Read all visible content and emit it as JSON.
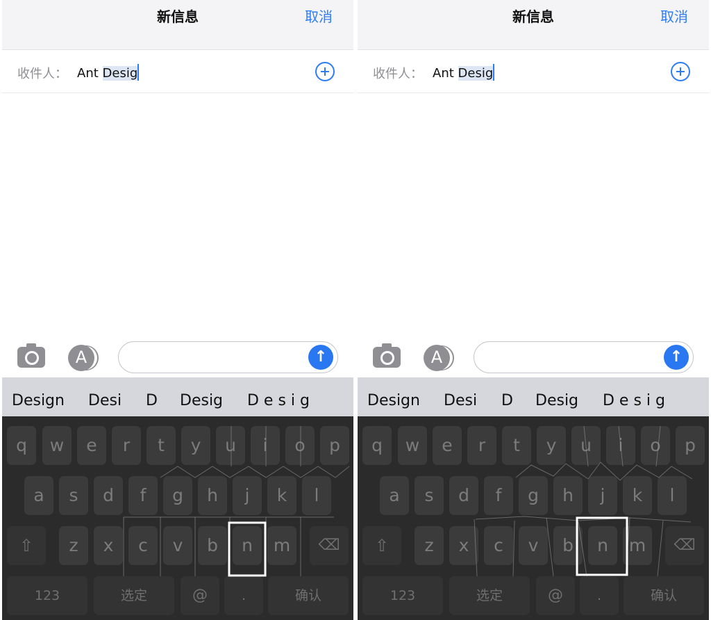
{
  "nav": {
    "title": "新信息",
    "cancel": "取消"
  },
  "recipient": {
    "label": "收件人：",
    "prefix": "Ant ",
    "highlight": "Desig"
  },
  "suggestions": [
    "Design",
    "Desi",
    "D",
    "Desig",
    "D e s i g"
  ],
  "keyboard": {
    "row1": [
      "q",
      "w",
      "e",
      "r",
      "t",
      "y",
      "u",
      "i",
      "o",
      "p"
    ],
    "row2": [
      "a",
      "s",
      "d",
      "f",
      "g",
      "h",
      "j",
      "k",
      "l"
    ],
    "row3": [
      "z",
      "x",
      "c",
      "v",
      "b",
      "n",
      "m"
    ],
    "num": "123",
    "select": "选定",
    "at": "@",
    "dot": ".",
    "confirm": "确认",
    "highlighted_key": "n"
  },
  "colors": {
    "accent": "#2d7cf6",
    "keyboard_bg": "#2b2b2b",
    "key_bg": "#3b3b3b",
    "suggestion_bg": "#d6d7dc"
  },
  "icons": [
    "camera-icon",
    "appstore-icon",
    "send-arrow-icon",
    "add-recipient-icon",
    "shift-icon",
    "backspace-icon"
  ]
}
